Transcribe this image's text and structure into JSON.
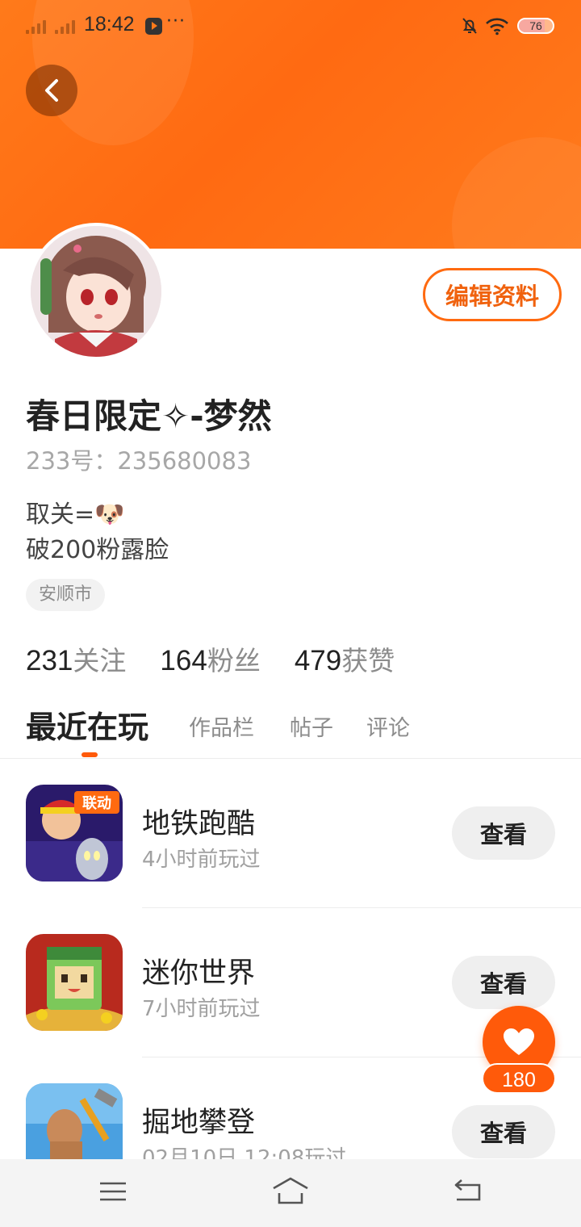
{
  "status_bar": {
    "time": "18:42",
    "more": "···",
    "battery": "76",
    "battery_level": 0.76
  },
  "profile": {
    "username": "春日限定✧-梦然",
    "id_line": "233号：235680083",
    "bio_line1": "取关=",
    "bio_emoji": "🐶",
    "bio_line2": "破200粉露脸",
    "location": "安顺市",
    "edit_button": "编辑资料"
  },
  "stats": [
    {
      "num": "231",
      "label": "关注"
    },
    {
      "num": "164",
      "label": "粉丝"
    },
    {
      "num": "479",
      "label": "获赞"
    }
  ],
  "tabs": [
    {
      "label": "最近在玩",
      "active": true
    },
    {
      "label": "作品栏"
    },
    {
      "label": "帖子"
    },
    {
      "label": "评论"
    }
  ],
  "games": [
    {
      "title": "地铁跑酷",
      "time": "4小时前玩过",
      "button": "查看",
      "badge": "联动"
    },
    {
      "title": "迷你世界",
      "time": "7小时前玩过",
      "button": "查看"
    },
    {
      "title": "掘地攀登",
      "time": "02月10日 12:08玩过",
      "button": "查看"
    }
  ],
  "like": {
    "count": "180"
  },
  "colors": {
    "accent": "#ff6a10",
    "banner": "#ff7a1a"
  }
}
